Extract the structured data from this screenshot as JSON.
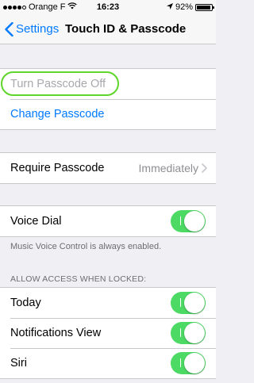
{
  "status_bar": {
    "carrier": "Orange F",
    "time": "16:23",
    "battery_percent": "92%",
    "battery_level": 0.92,
    "signal_bars_filled": 4,
    "signal_bars_total": 5,
    "icons": [
      "wifi-icon",
      "location-arrow-icon",
      "battery-icon"
    ]
  },
  "nav": {
    "back_label": "Settings",
    "title": "Touch ID & Passcode"
  },
  "passcode_group": {
    "turn_off_label": "Turn Passcode Off",
    "change_label": "Change Passcode"
  },
  "require_group": {
    "label": "Require Passcode",
    "value": "Immediately"
  },
  "voice_group": {
    "label": "Voice Dial",
    "on": true,
    "footer": "Music Voice Control is always enabled."
  },
  "locked_section": {
    "header": "ALLOW ACCESS WHEN LOCKED:",
    "items": [
      {
        "label": "Today",
        "on": true
      },
      {
        "label": "Notifications View",
        "on": true
      },
      {
        "label": "Siri",
        "on": true
      }
    ]
  },
  "colors": {
    "accent": "#007aff",
    "toggle_on": "#4cd964",
    "highlight": "#5fd62b",
    "background": "#efeff4"
  }
}
